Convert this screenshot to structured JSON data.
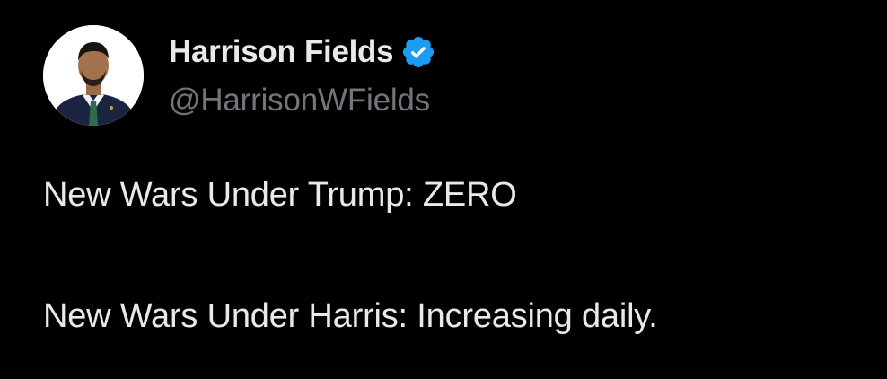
{
  "author": {
    "display_name": "Harrison Fields",
    "handle": "@HarrisonWFields",
    "verified": true,
    "verified_badge_icon": "verified-badge-icon",
    "avatar_icon": "profile-photo"
  },
  "tweet": {
    "lines": [
      "New Wars Under Trump: ZERO",
      "New Wars Under Harris: Increasing daily."
    ]
  },
  "colors": {
    "background": "#000000",
    "text_primary": "#e7e9ea",
    "text_secondary": "#71767b",
    "verified_blue": "#1d9bf0"
  }
}
